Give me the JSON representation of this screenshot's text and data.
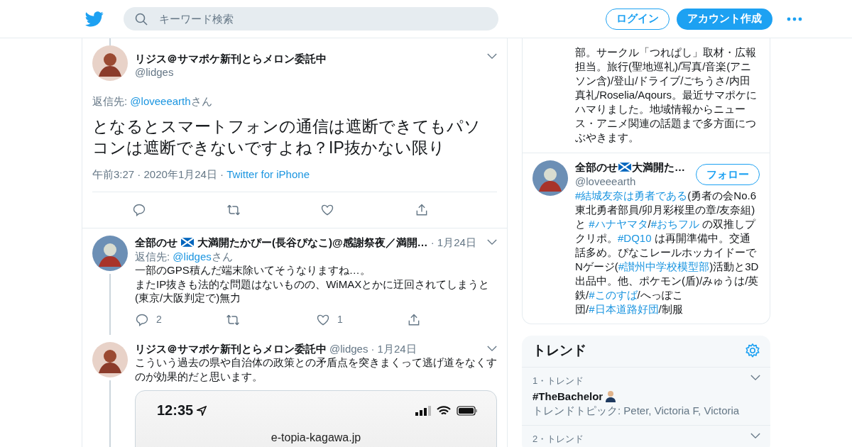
{
  "header": {
    "search": {
      "placeholder": "キーワード検索"
    },
    "login": "ログイン",
    "signup": "アカウント作成"
  },
  "main_tweet": {
    "name": "リジス＠サマポケ新刊とらメロン委託中",
    "handle": "@lidges",
    "reply_label": "返信先: ",
    "reply_to": "@loveeearth",
    "reply_suffix": "さん",
    "text": "となるとスマートフォンの通信は遮断できてもパソコンは遮断できないですよね？IP抜かない限り",
    "time": "午前3:27 · 2020年1月24日 ·",
    "source": "Twitter for iPhone"
  },
  "replies": [
    {
      "name_parts": [
        {
          "kind": "text",
          "text": "全部のせ"
        },
        {
          "kind": "flag"
        },
        {
          "kind": "text",
          "text": "大満開たかぴー(長谷ぴなこ)@感謝祭夜／満開…"
        }
      ],
      "date": "· 1月24日",
      "reply_label": "返信先: ",
      "reply_to": "@lidges",
      "reply_suffix": "さん",
      "text_lines": [
        "一部のGPS積んだ端末除いてそうなりますね…。",
        "またIP抜きも法的な問題はないものの、WiMAXとかに迂回されてしまうと(東京/大阪判定で)無力"
      ],
      "reply_count": "2",
      "like_count": "1"
    },
    {
      "name_parts": [
        {
          "kind": "text",
          "text": "リジス＠サマポケ新刊とらメロン委託中"
        }
      ],
      "handle": "@lidges",
      "date": "· 1月24日",
      "text_lines": [
        "こういう過去の県や自治体の政策との矛盾点を突きまくって逃げ道をなくすのが効果的だと思います。"
      ],
      "media": {
        "time": "12:35",
        "url": "e-topia-kagawa.jp"
      }
    }
  ],
  "sidebar": {
    "bio_card": {
      "bio": "部。サークル「つれぱし」取材・広報担当。旅行(聖地巡礼)/写真/音楽(アニソン含)/登山/ドライブ/ごちうさ/内田真礼/Roselia/Aqours。最近サマポケにハマりました。地域情報からニュース・アニメ関連の話題まで多方面につぶやきます。"
    },
    "user": {
      "name_parts": [
        {
          "kind": "text",
          "text": "全部のせ"
        },
        {
          "kind": "flag"
        },
        {
          "kind": "text",
          "text": "大満開た…"
        }
      ],
      "handle": "@loveeearth",
      "follow": "フォロー",
      "bio": [
        {
          "kind": "hashtag",
          "text": "#結城友奈は勇者である"
        },
        {
          "kind": "text",
          "text": "(勇者の会No.6東北勇者部員/卯月彩桜里の章/友奈組)と "
        },
        {
          "kind": "hashtag",
          "text": "#ハナヤマタ"
        },
        {
          "kind": "text",
          "text": "/"
        },
        {
          "kind": "hashtag",
          "text": "#おちフル"
        },
        {
          "kind": "text",
          "text": " の双推しプクリポ。"
        },
        {
          "kind": "hashtag",
          "text": "#DQ10"
        },
        {
          "kind": "text",
          "text": " は再開準備中。交通話多め。ぴなこレールホッカイドーでNゲージ("
        },
        {
          "kind": "hashtag",
          "text": "#讃州中学校模型部"
        },
        {
          "kind": "text",
          "text": ")活動と3D出品中。他、ポケモン(盾)/みゅうは/英鉄/"
        },
        {
          "kind": "hashtag",
          "text": "#このすば"
        },
        {
          "kind": "text",
          "text": "/へっぽこ団/"
        },
        {
          "kind": "hashtag",
          "text": "#日本道路好団"
        },
        {
          "kind": "text",
          "text": "/制服"
        }
      ]
    },
    "trends": {
      "title": "トレンド",
      "items": [
        {
          "meta": "1・トレンド",
          "name": "#TheBachelor",
          "emoji": true,
          "topics": "トレンドトピック: Peter, Victoria F, Victoria"
        },
        {
          "meta": "2・トレンド"
        }
      ]
    }
  }
}
